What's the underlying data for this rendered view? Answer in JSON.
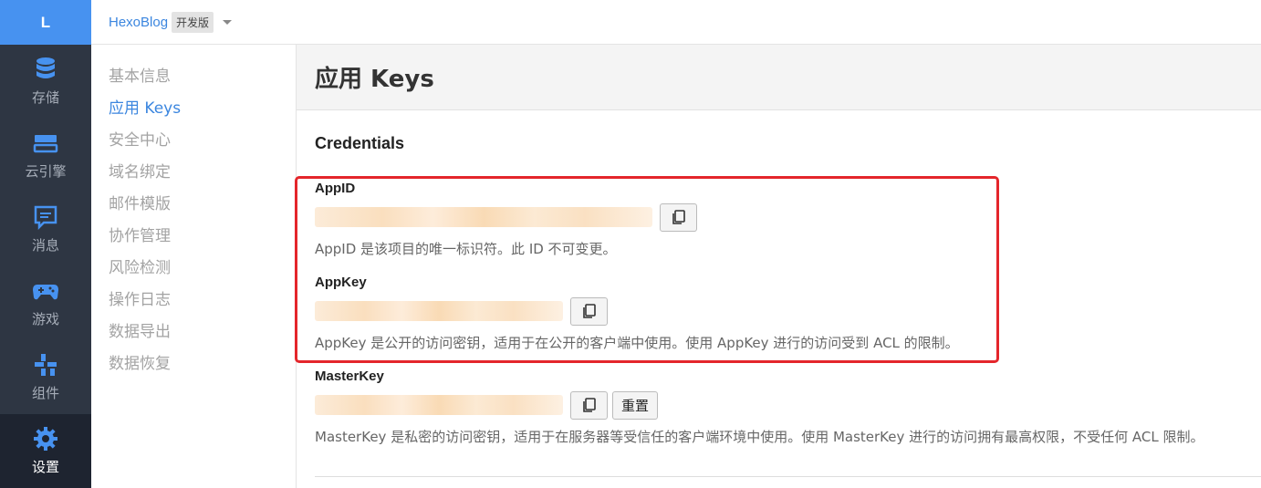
{
  "rail": {
    "logo": "L",
    "items": [
      {
        "label": "存储",
        "icon": "database-icon"
      },
      {
        "label": "云引擎",
        "icon": "server-icon"
      },
      {
        "label": "消息",
        "icon": "message-icon"
      },
      {
        "label": "游戏",
        "icon": "gamepad-icon"
      },
      {
        "label": "组件",
        "icon": "components-icon"
      },
      {
        "label": "设置",
        "icon": "gear-icon",
        "active": true
      }
    ]
  },
  "topbar": {
    "app_name": "HexoBlog",
    "env_badge": "开发版"
  },
  "subnav": {
    "items": [
      "基本信息",
      "应用 Keys",
      "安全中心",
      "域名绑定",
      "邮件模版",
      "协作管理",
      "风险检测",
      "操作日志",
      "数据导出",
      "数据恢复"
    ],
    "active": "应用 Keys"
  },
  "page": {
    "title": "应用 Keys",
    "section_title": "Credentials"
  },
  "credentials": {
    "appid": {
      "label": "AppID",
      "help": "AppID 是该项目的唯一标识符。此 ID 不可变更。"
    },
    "appkey": {
      "label": "AppKey",
      "help": "AppKey 是公开的访问密钥，适用于在公开的客户端中使用。使用 AppKey 进行的访问受到 ACL 的限制。"
    },
    "masterkey": {
      "label": "MasterKey",
      "reset_label": "重置",
      "help": "MasterKey 是私密的访问密钥，适用于在服务器等受信任的客户端环境中使用。使用 MasterKey 进行的访问拥有最高权限，不受任何 ACL 限制。"
    }
  },
  "colors": {
    "rail_bg": "#2e3643",
    "logo_bg": "#4792f0",
    "link_blue": "#3b86df",
    "highlight_red": "#e4262b"
  }
}
